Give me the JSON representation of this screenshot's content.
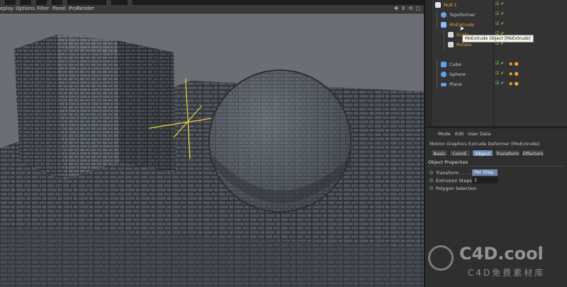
{
  "viewport": {
    "menu": [
      "eplay",
      "Options",
      "Filter",
      "Panel",
      "ProRender"
    ],
    "corner_icons": "✥ ⇕ ⟲ ▢"
  },
  "object_manager": {
    "rows": [
      {
        "name": "Null.1",
        "color": "#f0a030",
        "indent": 0,
        "icon": "null-icon",
        "flags": "☑ ✔",
        "tags": ""
      },
      {
        "name": "Topoformer",
        "color": "#c8c8c8",
        "indent": 1,
        "icon": "deformer-icon",
        "flags": "☑ ✔",
        "tags": ""
      },
      {
        "name": "MoExtrude",
        "color": "#f0a030",
        "indent": 1,
        "icon": "moextrude-icon",
        "flags": "☑ ✔",
        "tags": ""
      },
      {
        "name": "Scale",
        "color": "#f0a030",
        "indent": 2,
        "icon": "effector-icon",
        "flags": "☑ ✔",
        "tags": ""
      },
      {
        "name": "Rotate",
        "color": "#f0a030",
        "indent": 2,
        "icon": "effector-icon",
        "flags": "☑ ✔",
        "tags": ""
      },
      {
        "name": "Cube",
        "color": "#c8c8c8",
        "indent": 1,
        "icon": "cube-icon",
        "flags": "☑ ✔",
        "tags": "◆ ●"
      },
      {
        "name": "Sphere",
        "color": "#c8c8c8",
        "indent": 1,
        "icon": "sphere-icon",
        "flags": "☑ ✔",
        "tags": "◆ ●"
      },
      {
        "name": "Plane",
        "color": "#c8c8c8",
        "indent": 1,
        "icon": "plane-icon",
        "flags": "☑ ✔",
        "tags": "◆ ●"
      }
    ],
    "tooltip": "MoExtrude Object [MoExtrude]"
  },
  "attribute_manager": {
    "menu": [
      "Mode",
      "Edit",
      "User Data"
    ],
    "title": "Motion Graphics Extrude Deformer [MoExtrude]",
    "tabs": [
      "Basic",
      "Coord.",
      "Object",
      "Transform",
      "Effectors"
    ],
    "active_tab": "Object",
    "section": "Object Properties",
    "fields": [
      {
        "label": "Transform . . . . . . . .",
        "value": "Per Step",
        "kind": "dropdown"
      },
      {
        "label": "Extrusion Steps . .",
        "value": "1",
        "kind": "number"
      },
      {
        "label": "Polygon Selection",
        "value": "",
        "kind": "empty"
      }
    ]
  },
  "watermark": {
    "text": "C4D.cool",
    "sub": "C4D免费素材库"
  },
  "colors": {
    "accent": "#6f8db5",
    "orange": "#f0a030",
    "viewport_bg": "#6b6e72"
  }
}
